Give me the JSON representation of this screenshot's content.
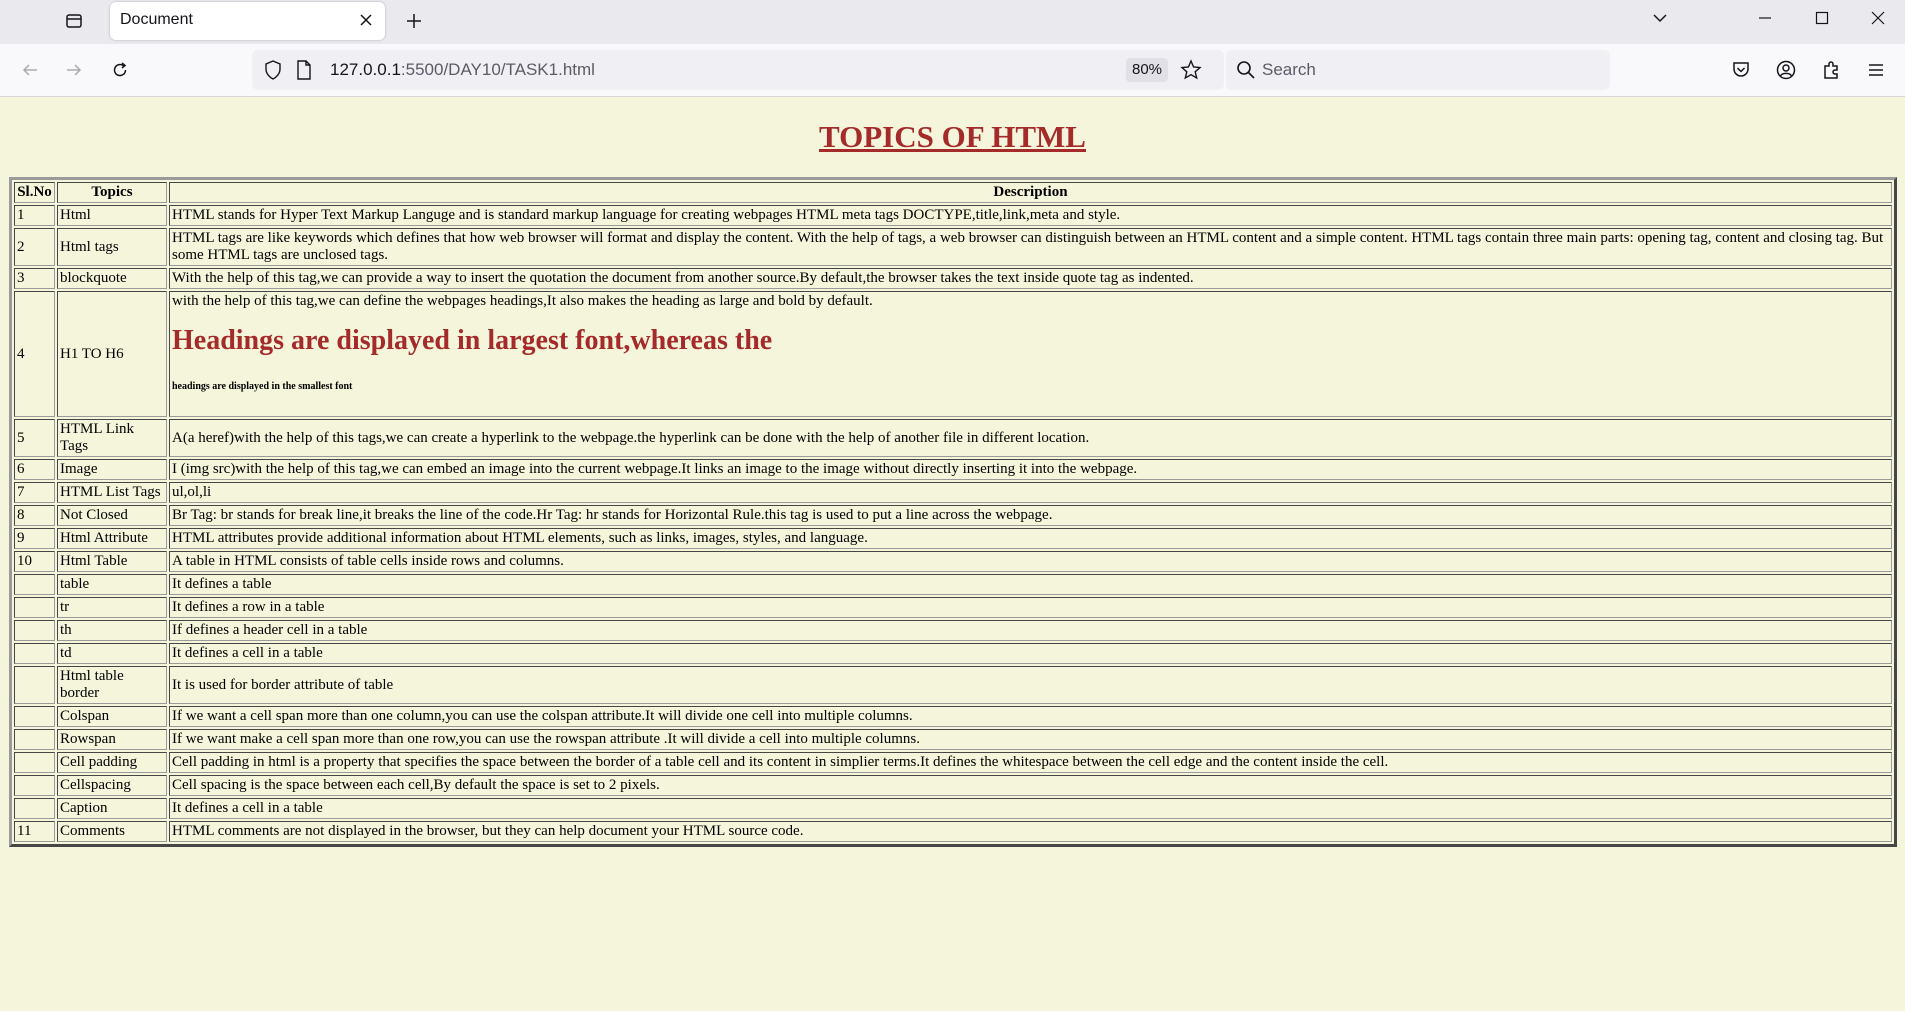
{
  "browser": {
    "tab_title": "Document",
    "url_host": "127.0.0.1",
    "url_rest": ":5500/DAY10/TASK1.html",
    "zoom": "80%",
    "search_placeholder": "Search"
  },
  "page": {
    "heading": "TOPICS OF HTML",
    "headers": [
      "Sl.No",
      "Topics",
      "Description"
    ],
    "rows": [
      {
        "no": "1",
        "topic": "Html",
        "desc": "HTML stands for Hyper Text Markup Languge and is standard markup language for creating webpages HTML meta tags DOCTYPE,title,link,meta and style."
      },
      {
        "no": "2",
        "topic": "Html tags",
        "desc": "HTML tags are like keywords which defines that how web browser will format and display the content. With the help of tags, a web browser can distinguish between an HTML content and a simple content. HTML tags contain three main parts: opening tag, content and closing tag. But some HTML tags are unclosed tags."
      },
      {
        "no": "3",
        "topic": "blockquote",
        "desc": "With the help of this tag,we can provide a way to insert the quotation the document from another source.By default,the browser takes the text inside quote tag as indented."
      },
      {
        "no": "4",
        "topic": "H1 TO H6",
        "desc": "with the help of this tag,we can define the webpages headings,It also makes the heading as large and bold by default.",
        "h1": "Headings are displayed in largest font,whereas the",
        "h6": "headings are displayed in the smallest font"
      },
      {
        "no": "5",
        "topic": "HTML Link Tags",
        "desc": "A(a heref)with the help of this tags,we can create a hyperlink to the webpage.the hyperlink can be done with the help of another file in different location."
      },
      {
        "no": "6",
        "topic": "Image",
        "desc": "I (img src)with the help of this tag,we can embed an image into the current webpage.It links an image to the image without directly inserting it into the webpage."
      },
      {
        "no": "7",
        "topic": "HTML List Tags",
        "desc": "ul,ol,li"
      },
      {
        "no": "8",
        "topic": "Not Closed",
        "desc": "Br Tag: br stands for break line,it breaks the line of the code.Hr Tag: hr stands for Horizontal Rule.this tag is used to put a line across the webpage."
      },
      {
        "no": "9",
        "topic": "Html Attribute",
        "desc": "HTML attributes provide additional information about HTML elements, such as links, images, styles, and language."
      },
      {
        "no": "10",
        "topic": "Html Table",
        "desc": "A table in HTML consists of table cells inside rows and columns."
      },
      {
        "no": "",
        "topic": "table",
        "desc": "It defines a table"
      },
      {
        "no": "",
        "topic": "tr",
        "desc": "It defines a row in a table"
      },
      {
        "no": "",
        "topic": "th",
        "desc": "If defines a header cell in a table"
      },
      {
        "no": "",
        "topic": "td",
        "desc": "It defines a cell in a table"
      },
      {
        "no": "",
        "topic": "Html table border",
        "desc": "It is used for border attribute of table"
      },
      {
        "no": "",
        "topic": "Colspan",
        "desc": "If we want a cell span more than one column,you can use the colspan attribute.It will divide one cell into multiple columns."
      },
      {
        "no": "",
        "topic": "Rowspan",
        "desc": "If we want make a cell span more than one row,you can use the rowspan attribute .It will divide a cell into multiple columns."
      },
      {
        "no": "",
        "topic": "Cell padding",
        "desc": "Cell padding in html is a property that specifies the space between the border of a table cell and its content in simplier terms.It defines the whitespace between the cell edge and the content inside the cell."
      },
      {
        "no": "",
        "topic": "Cellspacing",
        "desc": "Cell spacing is the space between each cell,By default the space is set to 2 pixels."
      },
      {
        "no": "",
        "topic": "Caption",
        "desc": "It defines a cell in a table"
      },
      {
        "no": "11",
        "topic": "Comments",
        "desc": "HTML comments are not displayed in the browser, but they can help document your HTML source code."
      }
    ]
  }
}
